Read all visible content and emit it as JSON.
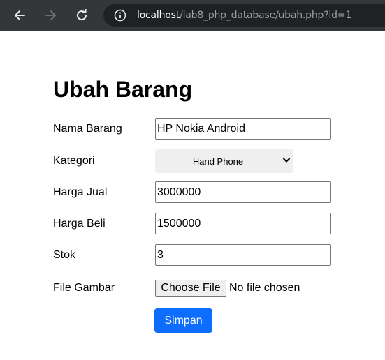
{
  "browser": {
    "url_host": "localhost",
    "url_path": "/lab8_php_database/ubah.php?id=1"
  },
  "page": {
    "title": "Ubah Barang"
  },
  "form": {
    "nama_label": "Nama Barang",
    "nama_value": "HP Nokia Android",
    "kategori_label": "Kategori",
    "kategori_value": "Hand Phone",
    "harga_jual_label": "Harga Jual",
    "harga_jual_value": "3000000",
    "harga_beli_label": "Harga Beli",
    "harga_beli_value": "1500000",
    "stok_label": "Stok",
    "stok_value": "3",
    "gambar_label": "File Gambar",
    "file_button_label": "Choose File",
    "file_status": "No file chosen",
    "submit_label": "Simpan"
  },
  "colors": {
    "toolbar_bg": "#35363a",
    "omnibox_bg": "#202124",
    "primary_button": "#0d6efd"
  }
}
